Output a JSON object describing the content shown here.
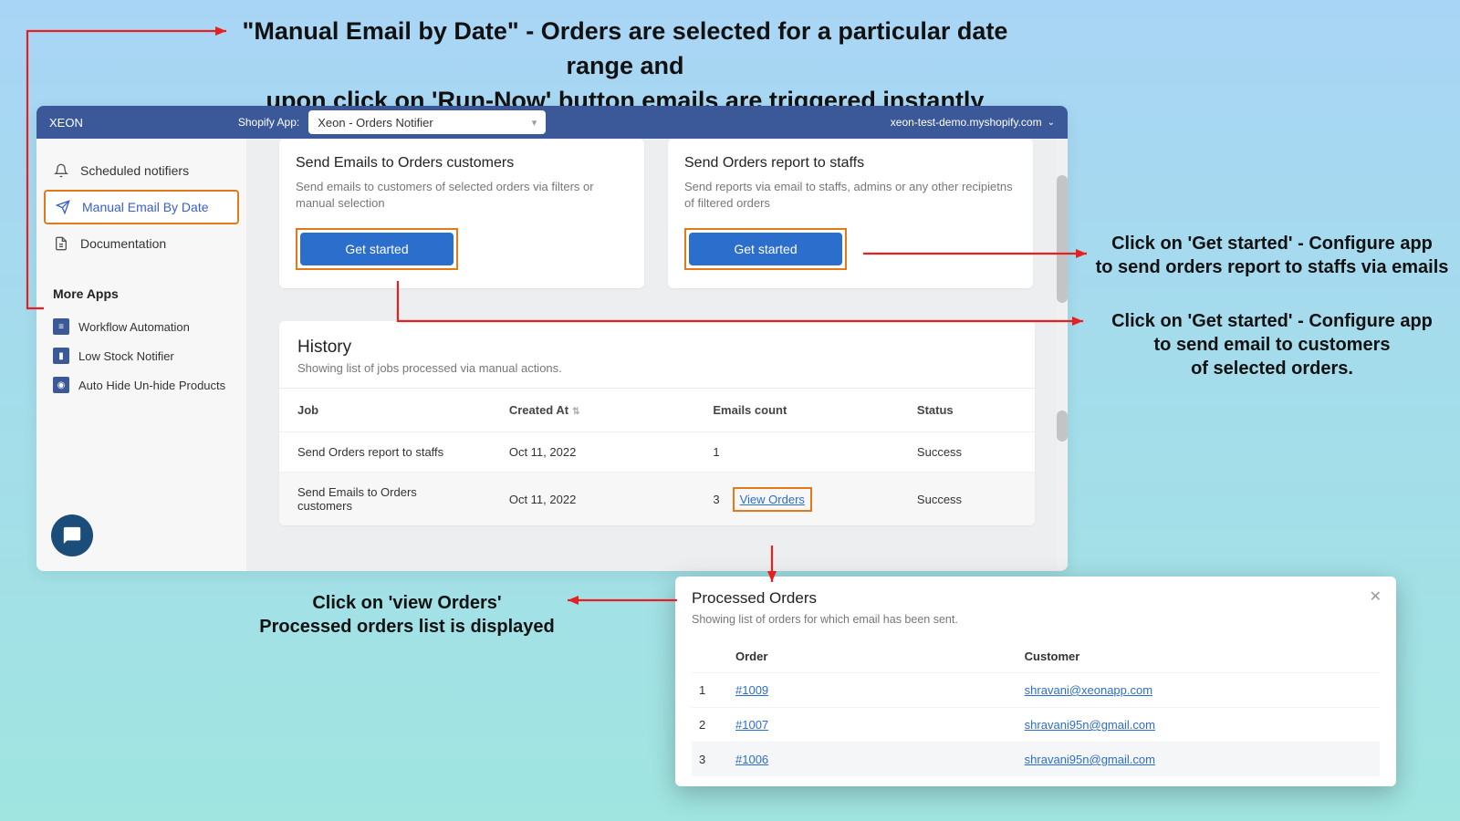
{
  "headline_l1": "\"Manual Email by Date\" - Orders are selected for a particular date range and",
  "headline_l2": "upon click on 'Run-Now' button emails are triggered instantly",
  "topbar": {
    "brand": "XEON",
    "app_label": "Shopify App:",
    "app_selected": "Xeon - Orders Notifier",
    "store": "xeon-test-demo.myshopify.com"
  },
  "sidebar": {
    "items": [
      {
        "label": "Scheduled notifiers"
      },
      {
        "label": "Manual Email By Date"
      },
      {
        "label": "Documentation"
      }
    ],
    "more_heading": "More Apps",
    "apps": [
      {
        "label": "Workflow Automation"
      },
      {
        "label": "Low Stock Notifier"
      },
      {
        "label": "Auto Hide Un-hide Products"
      }
    ]
  },
  "cards": {
    "customers": {
      "title": "Send Emails to Orders customers",
      "desc": "Send emails to customers of selected orders via filters or manual selection",
      "cta": "Get started"
    },
    "staffs": {
      "title": "Send Orders report to staffs",
      "desc": "Send reports via email to staffs, admins or any other recipietns of filtered orders",
      "cta": "Get started"
    }
  },
  "history": {
    "title": "History",
    "subtitle": "Showing list of jobs processed via manual actions.",
    "cols": {
      "job": "Job",
      "created": "Created At",
      "emails": "Emails count",
      "status": "Status"
    },
    "rows": [
      {
        "job": "Send Orders report to staffs",
        "created": "Oct 11, 2022",
        "count": "1",
        "view": "",
        "status": "Success"
      },
      {
        "job": "Send Emails to Orders customers",
        "created": "Oct 11, 2022",
        "count": "3",
        "view": "View Orders",
        "status": "Success"
      }
    ]
  },
  "modal": {
    "title": "Processed Orders",
    "subtitle": "Showing list of orders for which email has been sent.",
    "cols": {
      "order": "Order",
      "customer": "Customer"
    },
    "rows": [
      {
        "idx": "1",
        "order": "#1009",
        "customer": "shravani@xeonapp.com"
      },
      {
        "idx": "2",
        "order": "#1007",
        "customer": "shravani95n@gmail.com"
      },
      {
        "idx": "3",
        "order": "#1006",
        "customer": "shravani95n@gmail.com"
      }
    ]
  },
  "annotations": {
    "a1_l1": "Click on 'Get started' - Configure app",
    "a1_l2": "to send orders report to staffs via emails",
    "a2_l1": "Click on 'Get started' - Configure app",
    "a2_l2": "to send email to customers",
    "a2_l3": "of selected orders.",
    "a3_l1": "Click on 'view Orders'",
    "a3_l2": "Processed orders list is displayed"
  }
}
